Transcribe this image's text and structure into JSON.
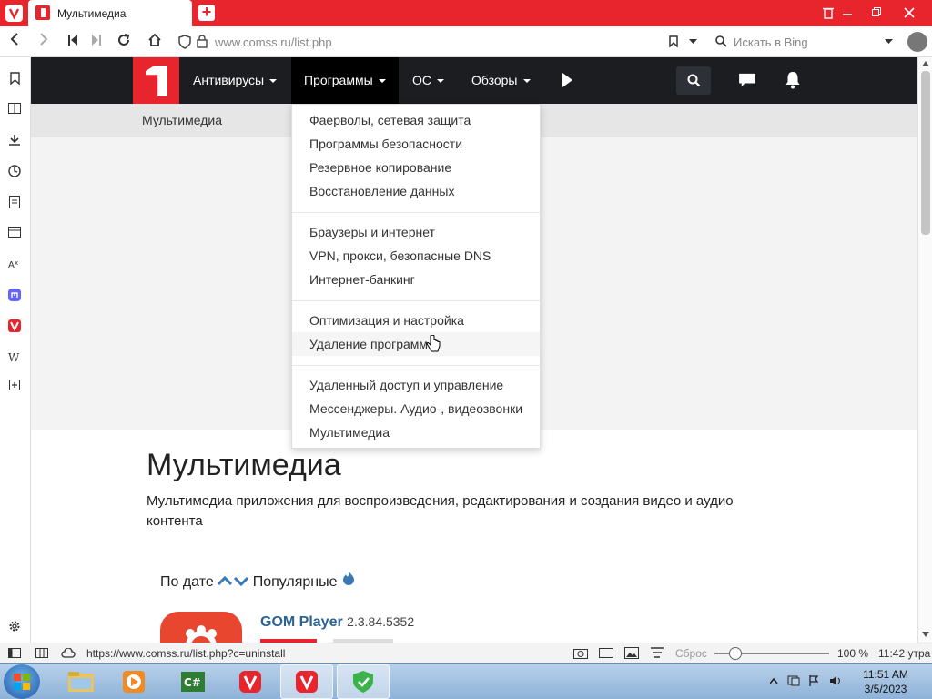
{
  "browser": {
    "tab_title": "Мультимедиа",
    "new_tab": "+",
    "url": "www.comss.ru/list.php",
    "search_placeholder": "Искать в Bing"
  },
  "site_nav": {
    "menu": [
      {
        "label": "Антивирусы"
      },
      {
        "label": "Программы"
      },
      {
        "label": "ОС"
      },
      {
        "label": "Обзоры"
      }
    ]
  },
  "breadcrumb": "Мультимедиа",
  "dropdown": {
    "groups": [
      [
        "Фаерволы, сетевая защита",
        "Программы безопасности",
        "Резервное копирование",
        "Восстановление данных"
      ],
      [
        "Браузеры и интернет",
        "VPN, прокси, безопасные DNS",
        "Интернет-банкинг"
      ],
      [
        "Оптимизация и настройка",
        "Удаление программ"
      ],
      [
        "Удаленный доступ и управление",
        "Мессенджеры. Аудио-, видеозвонки",
        "Мультимедиа"
      ]
    ]
  },
  "main": {
    "heading": "Мультимедиа",
    "description": "Мультимедиа приложения для воспроизведения, редактирования и создания видео и аудио контента",
    "sort_by_date": "По дате",
    "sort_popular": "Популярные",
    "app_name": "GOM Player",
    "app_version": "2.3.84.5352"
  },
  "statusbar": {
    "link_url": "https://www.comss.ru/list.php?c=uninstall",
    "reset": "Сброс",
    "zoom": "100 %",
    "time": "11:42 утра"
  },
  "taskbar": {
    "clock_time": "11:51 AM",
    "clock_date": "3/5/2023"
  },
  "colors": {
    "brand_red": "#e8242c",
    "nav_dark": "#1b1d21",
    "link_blue": "#2a6496"
  }
}
